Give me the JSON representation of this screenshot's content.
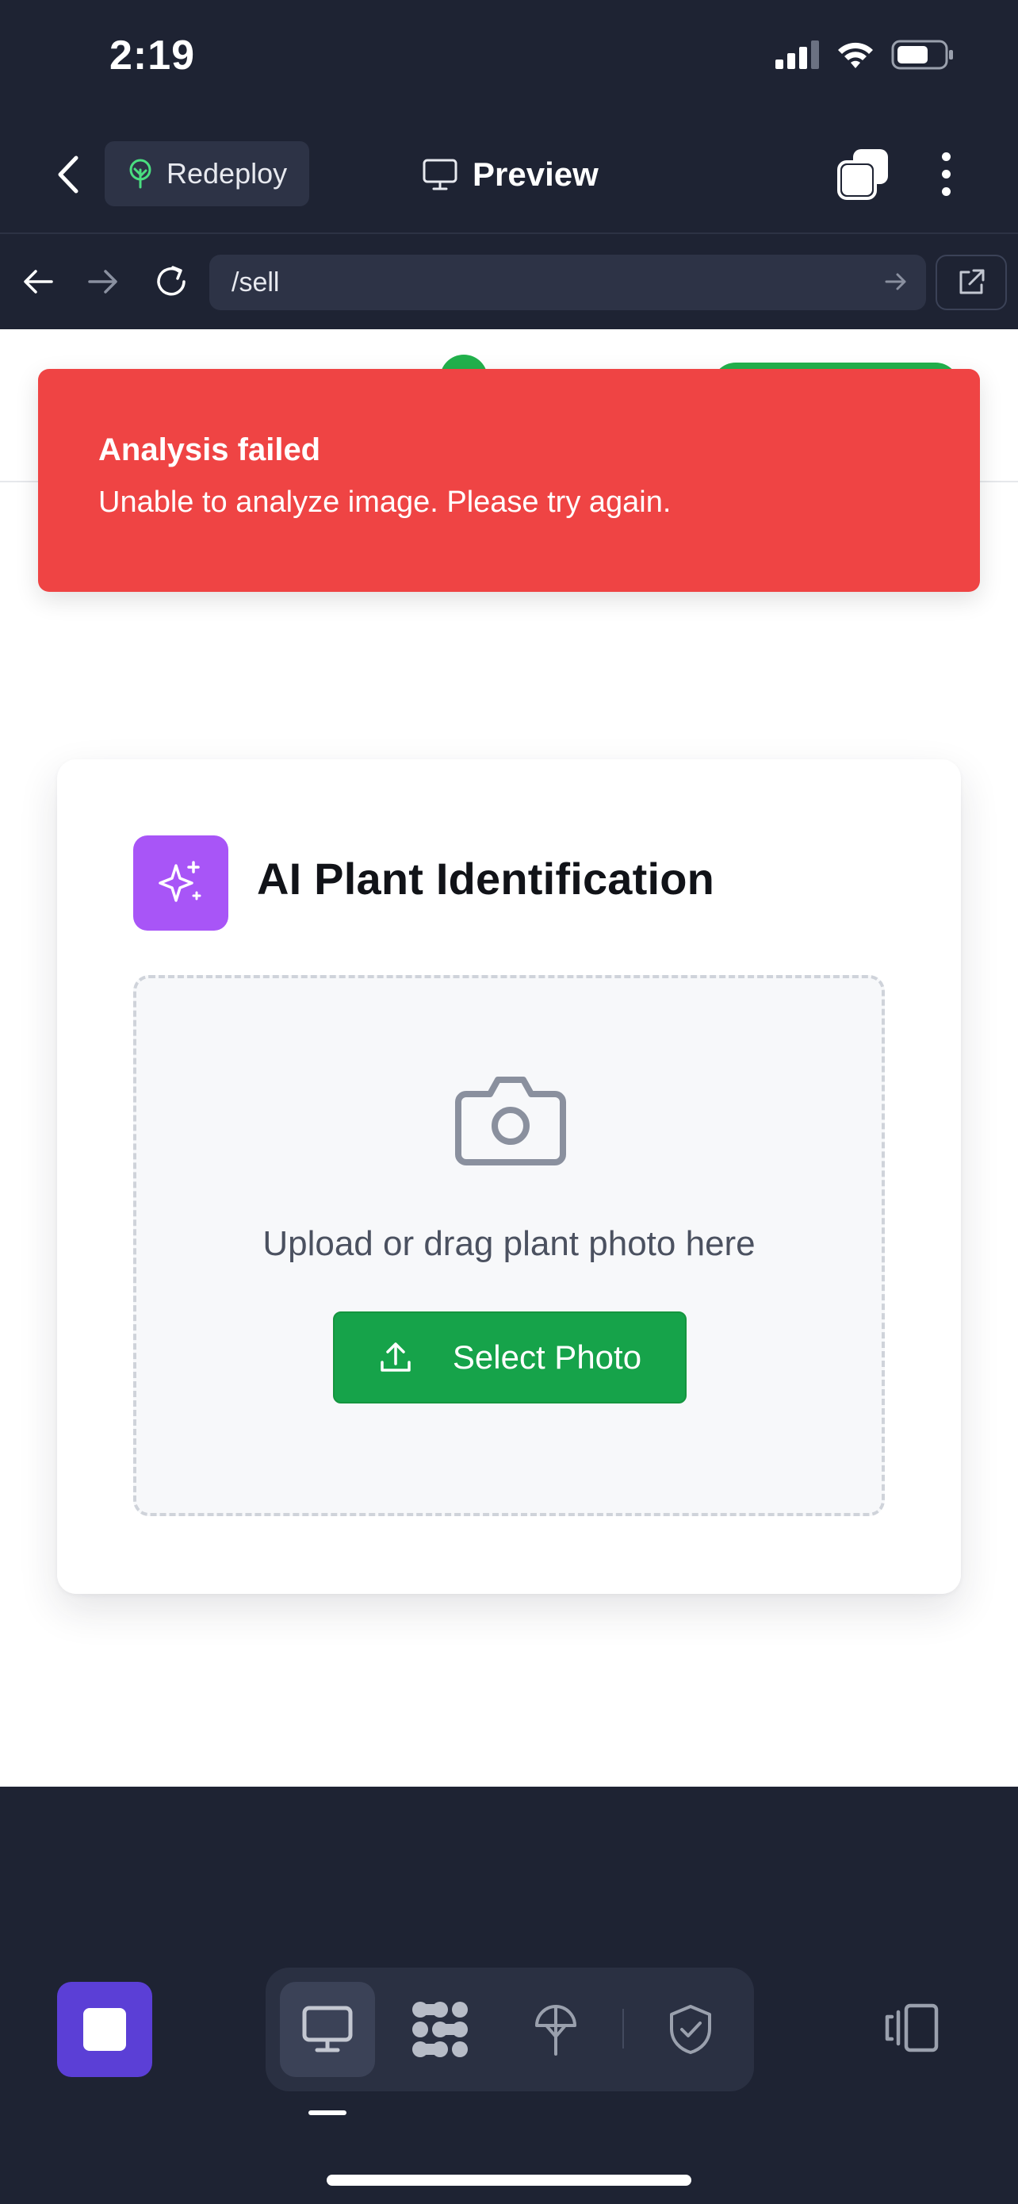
{
  "status_bar": {
    "time": "2:19"
  },
  "header": {
    "redeploy_label": "Redeploy",
    "preview_label": "Preview"
  },
  "browser": {
    "url": "/sell"
  },
  "toast": {
    "title": "Analysis failed",
    "message": "Unable to analyze image. Please try again."
  },
  "ai_card": {
    "title": "AI Plant Identification",
    "drop_text": "Upload or drag plant photo here",
    "select_button_label": "Select Photo"
  },
  "colors": {
    "toast_bg": "#ef4444",
    "accent_green": "#16a34a",
    "ai_icon_bg": "#a855f7",
    "toolbar_bg": "#1e2333"
  },
  "icons": {
    "header": [
      "chevron-left-icon",
      "tree-icon",
      "monitor-icon",
      "tabs-icon",
      "more-vertical-icon"
    ],
    "browser": [
      "arrow-left-icon",
      "arrow-right-icon",
      "refresh-icon",
      "arrow-right-small-icon",
      "external-link-icon"
    ],
    "toolbar": [
      "stop-icon",
      "monitor-icon",
      "blocks-icon",
      "tree-icon",
      "shield-check-icon",
      "device-switch-icon"
    ]
  }
}
